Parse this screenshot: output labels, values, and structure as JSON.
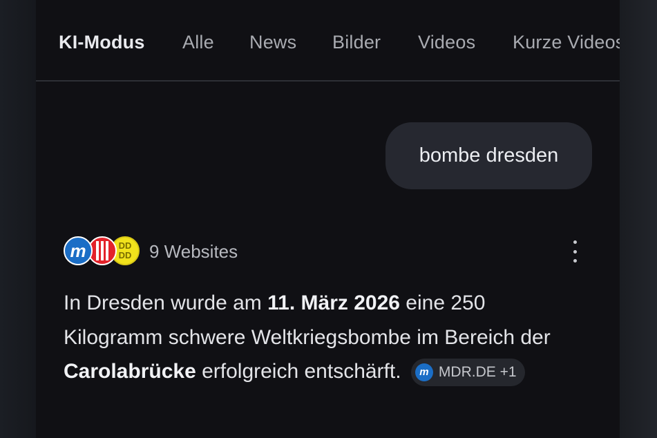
{
  "tabs": [
    {
      "label": "KI-Modus",
      "active": true
    },
    {
      "label": "Alle",
      "active": false
    },
    {
      "label": "News",
      "active": false
    },
    {
      "label": "Bilder",
      "active": false
    },
    {
      "label": "Videos",
      "active": false
    },
    {
      "label": "Kurze Videos",
      "active": false
    }
  ],
  "query": {
    "text": "bombe dresden"
  },
  "sources": {
    "count_label": "9 Websites",
    "favicons": [
      "mdr-icon",
      "bild-icon",
      "dd-icon"
    ],
    "menu_icon": "more-vert-icon"
  },
  "answer": {
    "part1": "In Dresden wurde am ",
    "date": "11. März 2026",
    "part2": " eine 250 Kilogramm schwere Weltkriegsbombe im Bereich der ",
    "place": "Carolabrücke",
    "part3": " erfolgreich entschärft.",
    "citation": {
      "icon": "mdr-icon",
      "label": "MDR.DE +1"
    }
  },
  "colors": {
    "background": "#101014",
    "bubble": "#262830",
    "mdr_blue": "#1b6ec6",
    "bild_red": "#e3222a",
    "dd_yellow": "#f1e21c"
  }
}
